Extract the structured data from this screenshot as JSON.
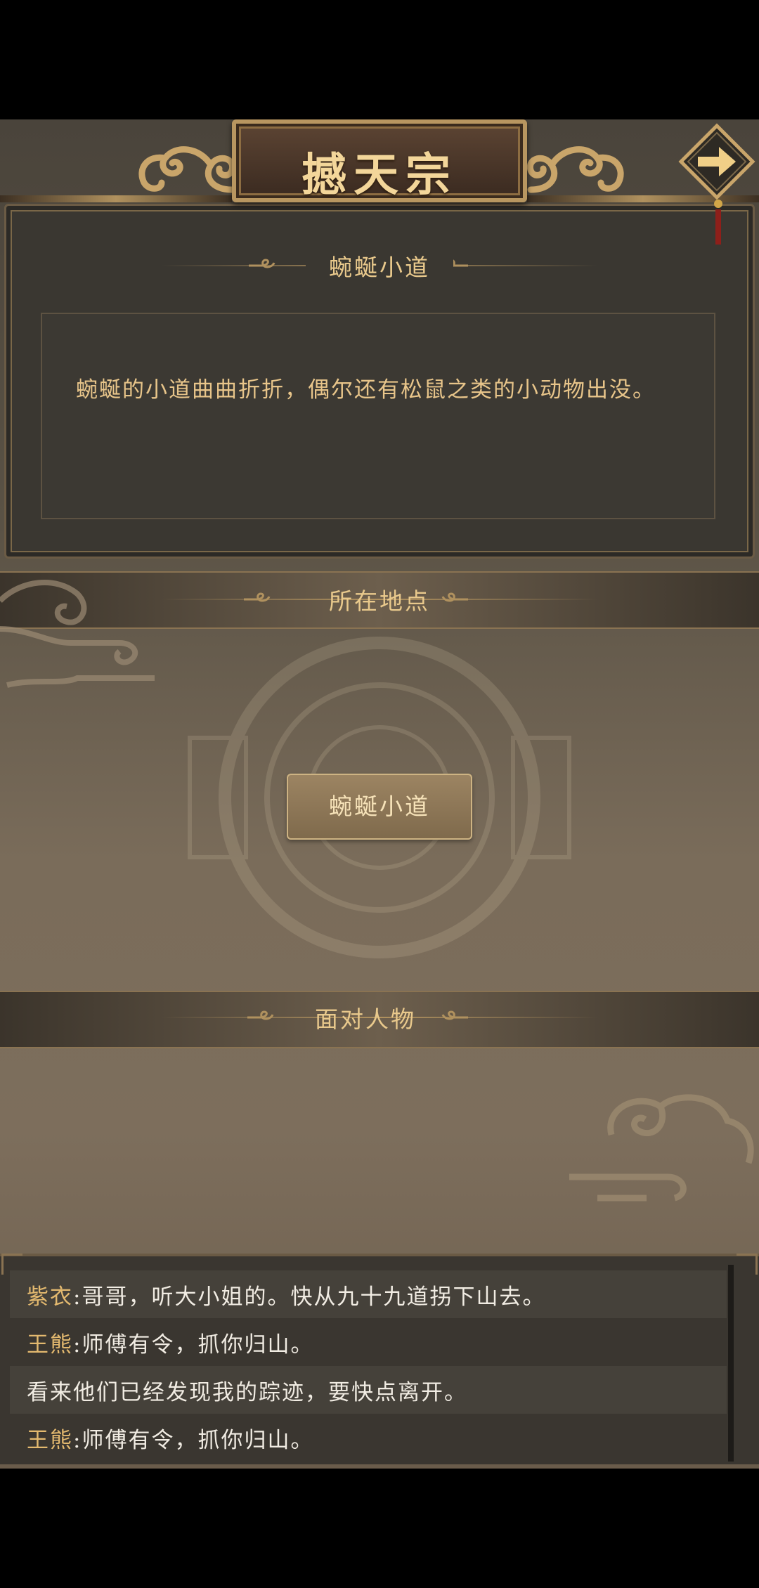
{
  "header": {
    "title": "撼天宗",
    "next_icon": "arrow-right-icon"
  },
  "description": {
    "section_title": "蜿蜒小道",
    "text": "蜿蜒的小道曲曲折折，偶尔还有松鼠之类的小动物出没。"
  },
  "location": {
    "section_title": "所在地点",
    "button_label": "蜿蜒小道"
  },
  "characters": {
    "section_title": "面对人物"
  },
  "log": [
    {
      "speaker": "紫衣",
      "text": ":哥哥，听大小姐的。快从九十九道拐下山去。"
    },
    {
      "speaker": "王熊",
      "text": ":师傅有令，抓你归山。"
    },
    {
      "speaker": "",
      "text": "看来他们已经发现我的踪迹，要快点离开。"
    },
    {
      "speaker": "王熊",
      "text": ":师傅有令，抓你归山。"
    }
  ],
  "colors": {
    "gold": "#e9c98c",
    "speaker": "#e3b96f",
    "panel": "#3a3731"
  }
}
